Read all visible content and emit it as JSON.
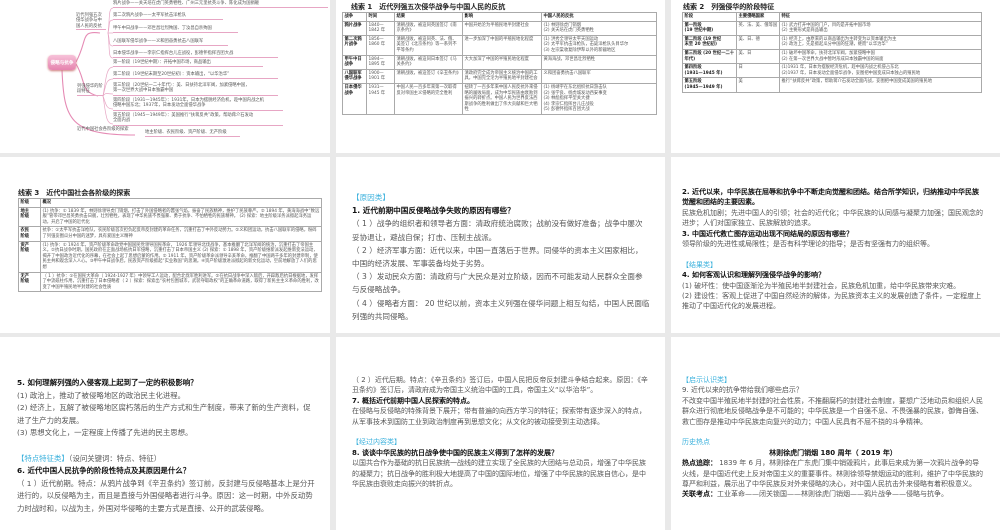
{
  "mindmap": {
    "center": "侵略与抗争",
    "branches": [
      {
        "label": "近代列强五次侵华战争与中国人民的反抗",
        "leaves": [
          "鸦片战争——关天培在虎门英勇牺牲、广州三元里抗英斗争、陈化成为国捐躯",
          "第二次鸦片战争——太平军抗击洋枪队",
          "甲午中日战争——邓世昌壮烈殉国、丁汝昌自杀殉国",
          "八国联军侵华战争——义和团奋勇抗击八国联军",
          "日本侵华战争——李宗仁指挥台儿庄战役，彭德怀指挥百团大战"
        ]
      },
      {
        "label": "列强侵华的阶段特征",
        "leaves": [
          "第一阶段（19世纪中期）：开拓中国市场，商品输出",
          "第二阶段（19世纪末期至20世纪初）：资本输出，“以华治华”",
          "第三阶段（20世纪一二十年代）：美、日扶持北洋军阀，加紧侵略中国，\n第一次世界大战中日本独霸中国",
          "第四阶段（1931—1945年）：1931年，日本为摆脱经济危机，趁中国内战之机\n侵略中国东北；1937年，日本发动全面侵华战争",
          "第五阶段（1945—1949年）：美国推行“扶蒋反共”政策，帮助蒋介石发动\n全面内战"
        ]
      },
      {
        "label": "近代中国社会各阶级的探索",
        "leaves": [
          "地主阶级、农民阶级、资产阶级、无产阶级"
        ]
      }
    ]
  },
  "slide2": {
    "title": "线索 1　近代列强五次侵华战争与中国人民的反抗",
    "headers": [
      "战争",
      "时间",
      "结果",
      "影响",
      "中国人民的反抗"
    ],
    "rows": [
      [
        "鸦片战争",
        "1840—\n1842 年",
        "清朝战败，被迫同英国签订《南京条约》",
        "中国开始沦为半殖民地半封建社会",
        "(1) 林则徐虎门销烟\n(2) 关天培在虎门英勇牺牲"
      ],
      [
        "第二次鸦片战争",
        "1856—\n1860 年",
        "清朝战败，被迫同英、法、俄、美签订《北京条约》等一系列不平等条约",
        "进一步加深了中国的半殖民地化程度",
        "(1) 洪秀全领导太平天国运动\n(2) 太平军抗击洋枪队，击毙洋枪队头目华尔\n(3) 左宗棠收复除伊犁以外的新疆地区"
      ],
      [
        "甲午中日战争",
        "1894—\n1895 年",
        "清朝战败，被迫同日本签订《马关条约》",
        "大大加深了中国的半殖民地化程度",
        "黄海海战，邓世昌壮烈牺牲"
      ],
      [
        "八国联军侵华战争",
        "1900—\n1901 年",
        "清朝战败，被迫签订《辛丑条约》",
        "清政府完全成为帝国主义统治中国的工具，中国完全沦为半殖民地半封建社会",
        "义和团奋勇抗击八国联军"
      ],
      [
        "日本侵华战争",
        "1931—\n1945 年",
        "中国人民一百多年来第一次取得反对帝国主义侵略的完全胜利",
        "扭转了一百多年来中国人民反抗外来侵略的屡败局面，成为中华民族由衰败到振兴的转折点。中国人民为世界反法西斯战争的胜利做出了伟大贡献和巨大牺牲",
        "(1) 杨靖宇在东北组织抗日游击队\n(2) 张学良、杨虎城发动西安事变\n(3) 林彪指挥平型关大捷\n(4) 李宗仁指挥台儿庄战役\n(5) 彭德怀指挥百团大战"
      ]
    ]
  },
  "slide3": {
    "title": "线索 2　列强侵华的阶段特征",
    "headers": [
      "阶段",
      "主要侵略国家",
      "特征"
    ],
    "rows": [
      [
        "第一阶段\n(19 世纪中期)",
        "英、法、美、俄等国",
        "(1) 武力打开中国的门户，目的是开拓中国市场\n(2) 主要形式是商品输出"
      ],
      [
        "第二阶段 (19 世纪\n末至 20 世纪初)",
        "美、日、德",
        "(1) 经济上，由原来的以商品输出为主转变为以资本输出为主\n(2) 政治上，先是掀起瓜分中国的狂潮，继而“以华治华”"
      ],
      [
        "第三阶段 (20 世纪一二十年代)",
        "美、日",
        "(1) 破坏中国革命，扶持北洋军阀，加紧侵略中国\n(2) 在第一次世界大战中暂时形成日本独霸中国的局面"
      ],
      [
        "第四阶段\n(1931—1945 年)",
        "日",
        "(1)1931 年，日本为摆脱经济危机，趁中国内战之机侵占东北\n(2)1937 年，日本发动全面侵华战争，妄图把中国变成日本独占的殖民地"
      ],
      [
        "第五阶段\n(1945—1949 年)",
        "美",
        "推行“扶蒋反共”政策，帮助蒋介石发动全面内战，妄图把中国变成美国的殖民地"
      ]
    ]
  },
  "slide4": {
    "title": "线索 3　近代中国社会各阶级的探索",
    "headers": [
      "阶级",
      "概况"
    ],
    "rows": [
      [
        "地主\n阶级",
        "(1) 抗争：① 1839 年，林则徐领导虎门销烟，打击了外国侵略者的嚣张气焰，振奋了民族精神，维护了民族尊严。② 1894 年，黄海海战中“致远舰”管带邓世昌英勇抗击日舰，壮烈牺牲，表现了中华民族不畏强暴、勇于抗争、不怕牺牲的民族精神。 (2) 探索：地主阶级洋务派掀起洋务运动，开启了中国的近代化"
      ],
      [
        "农民\n阶级",
        "抗争：①太平军抗击洋枪队，农民阶级首次担负起反帝反封建的革命任务，沉重打击了中外反动势力。②义和团运动，抗击八国联军的侵略，粉碎了列强妄图瓜分中国的迷梦，具有爱国主义精神"
      ],
      [
        "资产\n阶级",
        "(1) 抗争：① 1924 年，资产阶级革命政党中国国民党领导国民革命， 1926 年领导北伐战争，基本推翻了北洋军阀的统治，沉重打击了帝国主义。②抗日战争时期，国民政府在正面战场抵抗日军侵略，沉重打击了日本帝国主义 (2) 探索：① 1898 年，资产阶级维新派发起维新变法运动，揭开了中国政治近代化的序幕，在社会上起了思想启蒙的作用。② 1911 年，资产阶级革命派领导辛亥革命，推翻了中国两千多年的封建帝制，使民主共和观念深入人心。③甲午中日战争后，民族资产阶级掀起“实业救国”的思潮。④资产阶级激进派掀起的新文化运动，空前地解放了人们的思想"
      ],
      [
        "无产\n阶级",
        "（ 1 ）抗争：①在国民大革命（ 1924-1927 年）中领导工人运动，配合北伐军胜利进军。②在抗日战争中深入敌后，开辟敌后抗日根据地，发挥了中流砥柱作用，沉重打击了日本侵略者（ 2 ）探索：探索出“农村包围城市，武装夺取政权”的正确革命道路，取得了新民主主义革命的胜利，改变了中国半殖民地半封建的社会性质"
      ]
    ]
  },
  "slide5": [
    {
      "t": "tag",
      "text": "【原因类】"
    },
    {
      "t": "q",
      "text": "1. 近代前期中国反侵略战争失败的原因有哪些？"
    },
    {
      "t": "a",
      "text": "（ 1 ）战争的组织者和领导者方面：清政府统治腐败；战前没有做好准备；战争中屡次妥协退让，避战自保；打击、压制主战派。"
    },
    {
      "t": "a",
      "text": "（ 2 ）经济军事方面：近代以来，中国一直落后于世界。同侵华的资本主义国家相比，中国的经济发展、军事装备均处于劣势。"
    },
    {
      "t": "a",
      "text": "（ 3 ）发动民众方面：清政府与广大民众是对立阶级，因而不可能发动人民群众全面参与反侵略战争。"
    },
    {
      "t": "a",
      "text": "（ 4 ）侵略者方面： 20 世纪以前，资本主义列强在侵华问题上相互勾结，中国人民面临列强的共同侵略。"
    }
  ],
  "slide6": [
    {
      "t": "q",
      "text": "2. 近代以来，中华民族在屈辱和抗争中不断走向觉醒和团结。结合所学知识，归纳推动中华民族觉醒和团结的主要因素。"
    },
    {
      "t": "a",
      "text": "民族危机加剧；先进中国人的引领；社会的近代化；中华民族的认同感与凝聚力加强；国民观念的进步；人们对国家独立、民族解放的追求。"
    },
    {
      "t": "q",
      "text": "3. 中国近代救亡图存运动出现不同结局的原因有哪些？"
    },
    {
      "t": "a",
      "text": "领导阶级的先进性或局限性；是否有科学理论的指导；是否有坚强有力的组织等。"
    },
    {
      "t": "gap",
      "text": ""
    },
    {
      "t": "tag",
      "text": "【结果类】"
    },
    {
      "t": "q",
      "text": "4. 如何客观认识和理解列强侵华战争的影响？"
    },
    {
      "t": "a",
      "text": "(1) 破坏性：使中国逐渐沦为半殖民地半封建社会，民族危机加重，给中华民族带来灾难。"
    },
    {
      "t": "a",
      "text": "(2) 建设性：客观上促进了中国自然经济的解体，为民族资本主义的发展创造了条件，一定程度上推动了中国近代化的发展进程。"
    }
  ],
  "slide7": [
    {
      "t": "q",
      "text": "5. 如何理解列强的入侵客观上起到了一定的积极影响？"
    },
    {
      "t": "a",
      "text": "(1) 政治上，推动了被侵略地区的政治民主化进程。"
    },
    {
      "t": "a",
      "text": "(2) 经济上，瓦解了被侵略地区腐朽落后的生产方式和生产制度，带来了新的生产资料，促进了生产力的发展。"
    },
    {
      "t": "a",
      "text": "(3) 思想文化上，一定程度上传播了先进的民主思想。"
    },
    {
      "t": "gap",
      "text": ""
    },
    {
      "t": "tagx",
      "text": "【特点特征类】",
      "extra": "（设问关键词：特点、特征）"
    },
    {
      "t": "q",
      "text": "6. 近代中国人民抗争的阶段性特点及其原因是什么？"
    },
    {
      "t": "a",
      "text": "（ 1 ）近代前期。特点：从鸦片战争到《辛丑条约》签订前，反封建与反侵略基本上是分开进行的，以反侵略为主，而且是直接与外国侵略者进行斗争。原因：这一时期，中外反动势力时战时和，以战为主，外国对华侵略的主要方式是直接、公开的武装侵略。"
    }
  ],
  "slide8": [
    {
      "t": "a",
      "text": "（ 2 ）近代后期。特点：《辛丑条约》签订后，中国人民把反帝反封建斗争结合起来。原因：《辛丑条约》签订后，清政府成为帝国主义统治中国的工具，帝国主义“以华治华”。"
    },
    {
      "t": "q",
      "text": "7. 概括近代前期中国人民探索的特点。"
    },
    {
      "t": "a",
      "text": "在侵略与反侵略的特殊背景下展开；带有普遍的向西方学习的特征；探索带有逐步深入的特点，从军事技术到国防工业到政治制度再到思想文化；从文化的被动接受到主动选择。"
    },
    {
      "t": "gap",
      "text": ""
    },
    {
      "t": "tag",
      "text": "【经过内容类】"
    },
    {
      "t": "q",
      "text": "8. 谈谈中华民族的抗日战争使中国的民族主义得到了怎样的发展？"
    },
    {
      "t": "a",
      "text": "以国共合作为基础的抗日民族统一战线的建立实现了全民族的大团结与总动员，增强了中华民族的凝聚力；抗日战争的胜利极大地提高了中国的国际地位，增强了中华民族的民族自信心，是中华民族由衰败走向振兴的转折点。"
    }
  ],
  "slide9": [
    {
      "t": "tag",
      "text": "【启示认识类】"
    },
    {
      "t": "a",
      "text": "9. 近代以来的抗争带给我们哪些启示？"
    },
    {
      "t": "a",
      "text": "不改变中国半殖民地半封建的社会性质，不推翻腐朽的封建社会制度，要想广泛地动员和组织人民群众进行彻底地反侵略战争是不可能的；中华民族是一个自强不息、不畏强暴的民族，御侮自强、救亡图存是推动中华民族走向复兴的动力；中国人民具有不屈不挠的斗争精神。"
    },
    {
      "t": "gap",
      "text": ""
    },
    {
      "t": "tag",
      "text": "历史热点"
    },
    {
      "t": "ctr",
      "text": "林则徐虎门销烟 180 周年（ 2019 年）"
    },
    {
      "t": "lbl",
      "label": "热点追踪：",
      "text": " 1839 年 6 月，林则徐在广东虎门集中销毁鸦片，此事后来成为第一次鸦片战争的导火线，是中国近代史上反对帝国主义的重要事件。林则徐领导禁烟运动的胜利，维护了中华民族的尊严和利益，展示出了中华民族反对外来侵略的决心，对中国人民抗击外来侵略有着积极意义。"
    },
    {
      "t": "lbl",
      "label": "关联考点：",
      "text": "工业革命——闭关锁国——林则徐虎门销烟——鸦片战争——侵略与抗争。"
    }
  ],
  "colors": {
    "tag": "#39b0dc",
    "mindmap_pink": "#e583ae",
    "gap": "#e9e9e9"
  }
}
